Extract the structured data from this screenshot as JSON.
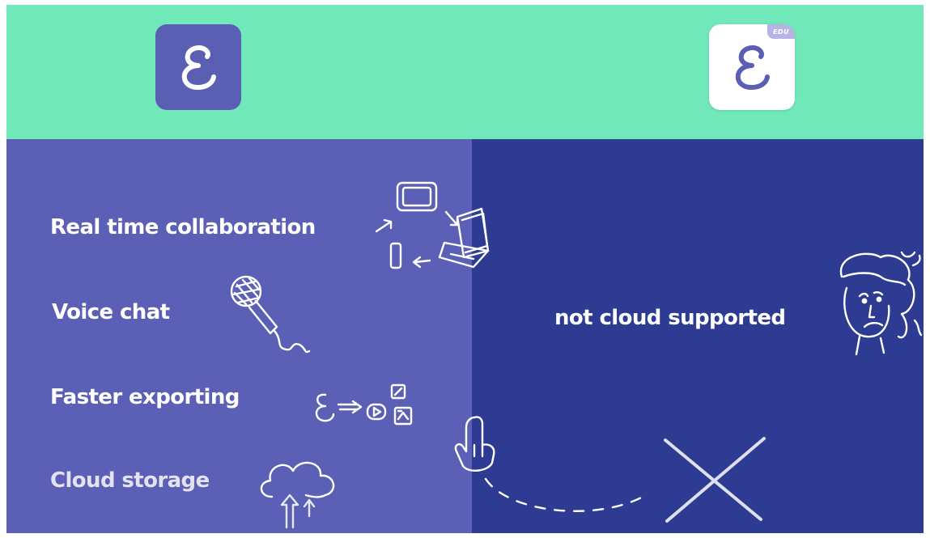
{
  "features": {
    "realtime": "Real time collaboration",
    "voice": "Voice chat",
    "export": "Faster exporting",
    "cloud": "Cloud storage"
  },
  "edu": {
    "badge": "EDU",
    "note": "not cloud supported"
  },
  "icons": {
    "logo_standard": "logo-e-icon",
    "logo_edu": "logo-e-edu-icon",
    "devices": "devices-sync-icon",
    "microphone": "microphone-icon",
    "export": "export-formats-icon",
    "cloud": "cloud-upload-icon",
    "sad_face": "sad-face-icon",
    "pointing_hand": "pointing-hand-icon",
    "x_mark": "x-mark-icon"
  },
  "colors": {
    "top_bar": "#70e8ba",
    "left_panel": "#5b60b6",
    "right_panel": "#2e3b93",
    "logo_background": "#5a5fb4",
    "text": "#ffffff"
  }
}
